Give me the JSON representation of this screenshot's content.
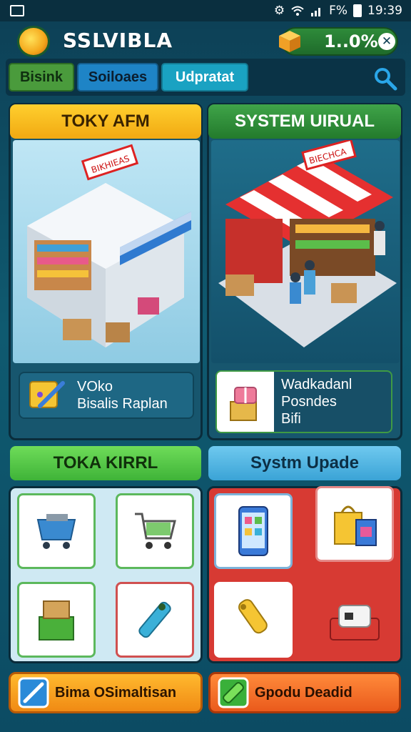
{
  "status_bar": {
    "indicator": "F%",
    "time": "19:39",
    "icons": [
      "gallery-icon",
      "settings-icon",
      "wifi-icon",
      "signal-icon",
      "battery-icon"
    ]
  },
  "header": {
    "app_name": "SSLVIBLA",
    "progress": "1..0%"
  },
  "tabs": [
    {
      "label": "Bisink"
    },
    {
      "label": "Soiloaes"
    },
    {
      "label": "Udpratat"
    }
  ],
  "panels": {
    "top_left": {
      "title": "TOKY AFM",
      "sign": "BIKHIEAS",
      "info_lines": [
        "VOko",
        "Bisalis Raplan"
      ]
    },
    "top_right": {
      "title": "SYSTEM UIRUAL",
      "sign": "BIECHCA",
      "info_lines": [
        "Wadkadanl",
        "Posndes",
        "Bifi"
      ]
    },
    "bottom_left": {
      "title": "TOKA KIRRL",
      "tiles": [
        "bin-cart-icon",
        "shopping-cart-icon",
        "crate-icon",
        "scanner-icon"
      ]
    },
    "bottom_right": {
      "title": "Systm Upade",
      "tiles": [
        "smartphone-icon",
        "shopping-bags-icon",
        "price-tag-icon",
        "printer-icon"
      ]
    }
  },
  "bottom_buttons": [
    {
      "label": "Bima OSimaltisan"
    },
    {
      "label": "Gpodu Deadid"
    }
  ],
  "colors": {
    "background": "#0f5a70",
    "yellow_title": "#f1a912",
    "green_title": "#237a2c",
    "light_green_title": "#3fb338",
    "blue_title": "#3aa3d6",
    "red_panel": "#d73a33"
  }
}
